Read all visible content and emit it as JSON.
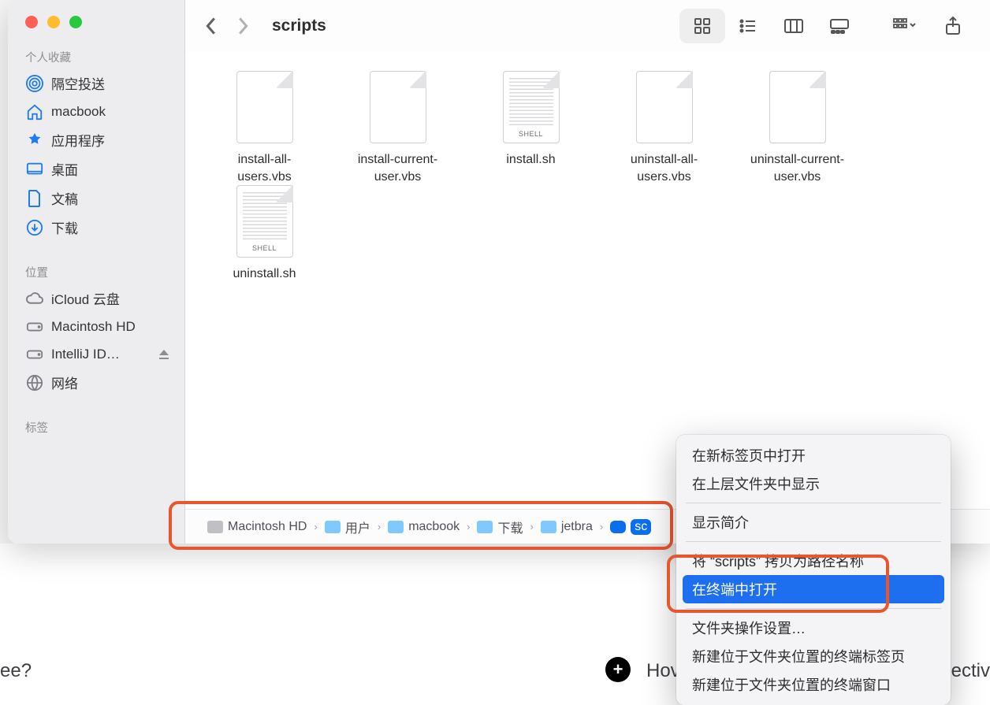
{
  "window": {
    "title": "scripts"
  },
  "sidebar": {
    "sections": {
      "favorites": "个人收藏",
      "locations": "位置",
      "tags": "标签"
    },
    "favorites": [
      {
        "icon": "airdrop",
        "label": "隔空投送"
      },
      {
        "icon": "home",
        "label": "macbook"
      },
      {
        "icon": "apps",
        "label": "应用程序"
      },
      {
        "icon": "desktop",
        "label": "桌面"
      },
      {
        "icon": "doc",
        "label": "文稿"
      },
      {
        "icon": "download",
        "label": "下载"
      }
    ],
    "locations": [
      {
        "icon": "icloud",
        "label": "iCloud 云盘",
        "grey": true
      },
      {
        "icon": "disk",
        "label": "Macintosh HD",
        "grey": true
      },
      {
        "icon": "disk",
        "label": "IntelliJ ID…",
        "grey": true,
        "eject": true
      },
      {
        "icon": "globe",
        "label": "网络",
        "grey": true
      }
    ]
  },
  "files": [
    {
      "name": "install-all-users.vbs",
      "kind": "plain"
    },
    {
      "name": "install-current-user.vbs",
      "kind": "plain"
    },
    {
      "name": "install.sh",
      "kind": "shell"
    },
    {
      "name": "uninstall-all-users.vbs",
      "kind": "plain"
    },
    {
      "name": "uninstall-current-user.vbs",
      "kind": "plain"
    },
    {
      "name": "uninstall.sh",
      "kind": "shell"
    }
  ],
  "shell_tag": "SHELL",
  "pathbar": [
    {
      "label": "Macintosh HD",
      "type": "hd"
    },
    {
      "label": "用户",
      "type": "folder"
    },
    {
      "label": "macbook",
      "type": "folder"
    },
    {
      "label": "下载",
      "type": "folder"
    },
    {
      "label": "jetbra",
      "type": "folder"
    },
    {
      "label": "sc",
      "type": "selected"
    }
  ],
  "context_menu": {
    "items": [
      {
        "label": "在新标签页中打开"
      },
      {
        "label": "在上层文件夹中显示"
      },
      {
        "sep": true
      },
      {
        "label": "显示简介"
      },
      {
        "sep": true
      },
      {
        "label": "将 “scripts” 拷贝为路径名称"
      },
      {
        "label": "在终端中打开",
        "highlight": true
      },
      {
        "sep": true
      },
      {
        "label": "文件夹操作设置…"
      },
      {
        "label": "新建位于文件夹位置的终端标签页"
      },
      {
        "label": "新建位于文件夹位置的终端窗口"
      }
    ]
  },
  "backdrop": {
    "left_fragment": "ee?",
    "right_fragment": "Hov",
    "right_tail": "ectiv",
    "plus": "+"
  }
}
